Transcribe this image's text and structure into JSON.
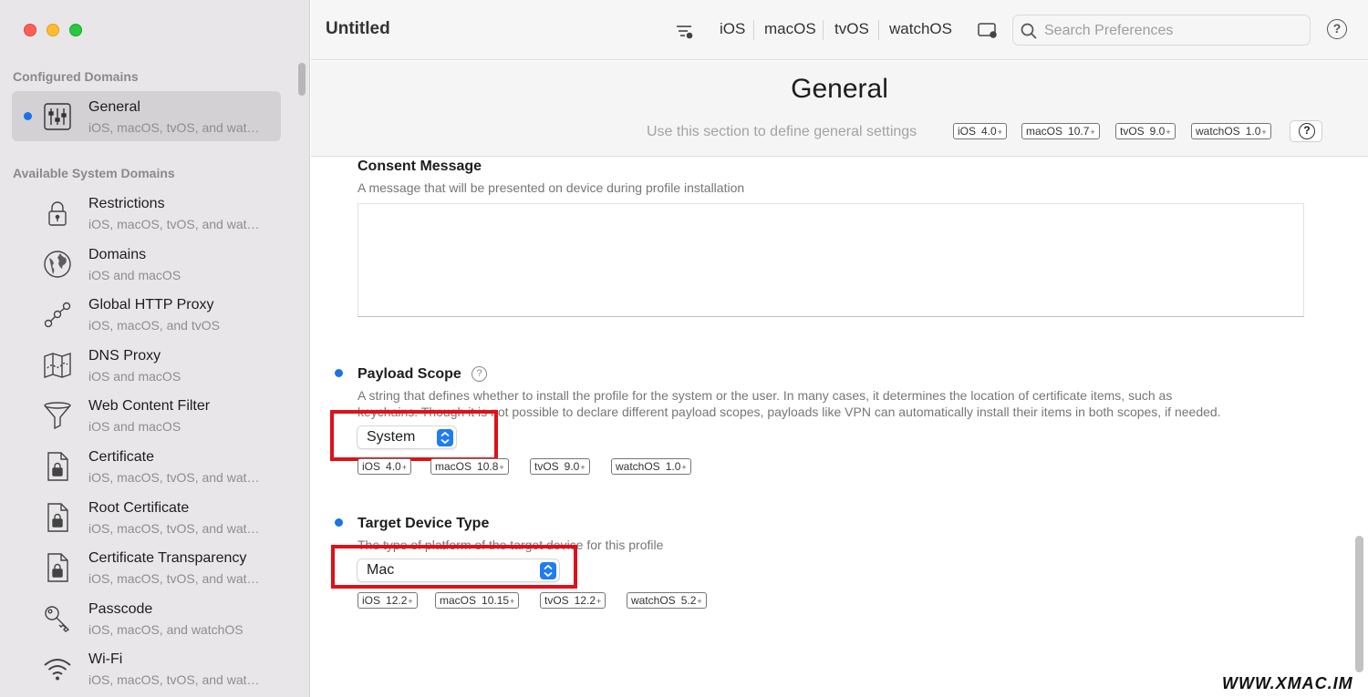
{
  "window": {
    "title": "Untitled"
  },
  "sidebar": {
    "configured_header": "Configured Domains",
    "available_header": "Available System Domains",
    "configured": [
      {
        "title": "General",
        "subtitle": "iOS, macOS, tvOS, and wat…",
        "icon": "sliders-icon"
      }
    ],
    "available": [
      {
        "title": "Restrictions",
        "subtitle": "iOS, macOS, tvOS, and wat…",
        "icon": "lock-icon"
      },
      {
        "title": "Domains",
        "subtitle": "iOS and macOS",
        "icon": "globe-icon"
      },
      {
        "title": "Global HTTP Proxy",
        "subtitle": "iOS, macOS, and tvOS",
        "icon": "proxy-nodes-icon"
      },
      {
        "title": "DNS Proxy",
        "subtitle": "iOS and macOS",
        "icon": "map-icon"
      },
      {
        "title": "Web Content Filter",
        "subtitle": "iOS and macOS",
        "icon": "funnel-icon"
      },
      {
        "title": "Certificate",
        "subtitle": "iOS, macOS, tvOS, and wat…",
        "icon": "certificate-lock-icon"
      },
      {
        "title": "Root Certificate",
        "subtitle": "iOS, macOS, tvOS, and wat…",
        "icon": "root-certificate-icon"
      },
      {
        "title": "Certificate Transparency",
        "subtitle": "iOS, macOS, tvOS, and wat…",
        "icon": "certificate-transparency-icon"
      },
      {
        "title": "Passcode",
        "subtitle": "iOS, macOS, and watchOS",
        "icon": "key-icon"
      },
      {
        "title": "Wi-Fi",
        "subtitle": "iOS, macOS, tvOS, and wat…",
        "icon": "wifi-icon"
      }
    ]
  },
  "toolbar": {
    "platforms": [
      "iOS",
      "macOS",
      "tvOS",
      "watchOS"
    ],
    "search_placeholder": "Search Preferences",
    "help": "?"
  },
  "header": {
    "title": "General",
    "description": "Use this section to define general settings",
    "badges": [
      {
        "os": "iOS",
        "ver": "4.0"
      },
      {
        "os": "macOS",
        "ver": "10.7"
      },
      {
        "os": "tvOS",
        "ver": "9.0"
      },
      {
        "os": "watchOS",
        "ver": "1.0"
      }
    ],
    "help": "?"
  },
  "consent": {
    "label": "Consent Message",
    "description": "A message that will be presented on device during profile installation",
    "value": ""
  },
  "payload_scope": {
    "label": "Payload Scope",
    "help": "?",
    "description_line1": "A string that defines whether to install the profile for the system or the user. In many cases, it determines the location of certificate items, such as",
    "description_line2": "keychains. Though it is not possible to declare different payload scopes, payloads like VPN can automatically install their items in both scopes, if needed.",
    "selected": "System",
    "badges": [
      {
        "os": "iOS",
        "ver": "4.0"
      },
      {
        "os": "macOS",
        "ver": "10.8"
      },
      {
        "os": "tvOS",
        "ver": "9.0"
      },
      {
        "os": "watchOS",
        "ver": "1.0"
      }
    ]
  },
  "target_device": {
    "label": "Target Device Type",
    "description": "The type of platform of the target device for this profile",
    "selected": "Mac",
    "badges": [
      {
        "os": "iOS",
        "ver": "12.2"
      },
      {
        "os": "macOS",
        "ver": "10.15"
      },
      {
        "os": "tvOS",
        "ver": "12.2"
      },
      {
        "os": "watchOS",
        "ver": "5.2"
      }
    ]
  },
  "badge_suffix": "+",
  "watermark": {
    "brand": "WWW.XMAC.IM"
  },
  "colors": {
    "accent": "#1a73e8",
    "highlight": "#e01018",
    "sidebar_bg": "#e8e6e8"
  }
}
